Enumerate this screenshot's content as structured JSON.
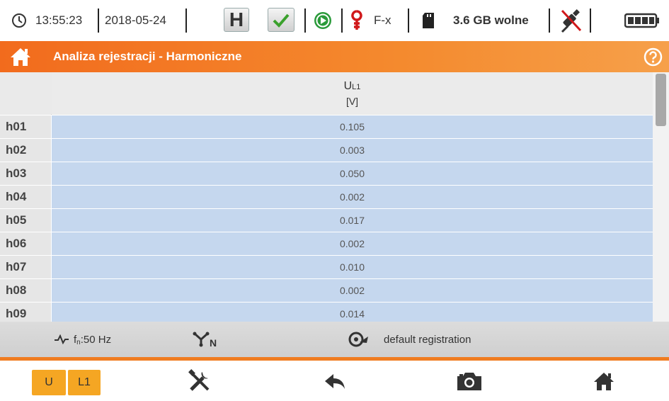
{
  "statusbar": {
    "time": "13:55:23",
    "date": "2018-05-24",
    "hold_label": "H",
    "connection_label": "F-x",
    "memory": "3.6 GB wolne"
  },
  "header": {
    "title": "Analiza rejestracji - Harmoniczne"
  },
  "table": {
    "column": {
      "name": "U",
      "sub": "L1",
      "unit": "[V]"
    },
    "rows": [
      {
        "label": "h01",
        "value": "0.105"
      },
      {
        "label": "h02",
        "value": "0.003"
      },
      {
        "label": "h03",
        "value": "0.050"
      },
      {
        "label": "h04",
        "value": "0.002"
      },
      {
        "label": "h05",
        "value": "0.017"
      },
      {
        "label": "h06",
        "value": "0.002"
      },
      {
        "label": "h07",
        "value": "0.010"
      },
      {
        "label": "h08",
        "value": "0.002"
      },
      {
        "label": "h09",
        "value": "0.014"
      }
    ]
  },
  "infobar": {
    "frequency_prefix": "f",
    "frequency_sub": "n",
    "frequency_value": ":50 Hz",
    "network_sub": "N",
    "registration": "default registration"
  },
  "toolbar": {
    "u_label": "U",
    "l1_label": "L1"
  },
  "colors": {
    "accent": "#f07c20",
    "row_fill": "#c5d7ee",
    "button_fill": "#f5a623"
  }
}
